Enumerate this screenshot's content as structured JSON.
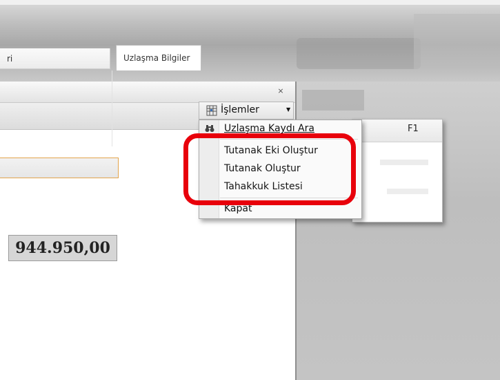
{
  "dialog": {
    "tabs": [
      {
        "label": "ri"
      },
      {
        "label": "Uzlaşma Bilgiler"
      }
    ],
    "amount": "944.950,00"
  },
  "menu": {
    "title": "İşlemler",
    "items": [
      {
        "label": "Uzlaşma Kaydı Ara",
        "icon": "search-record-icon"
      },
      {
        "label": "Tutanak Eki Oluştur"
      },
      {
        "label": "Tutanak Oluştur"
      },
      {
        "label": "Tahakkuk Listesi"
      },
      {
        "label": "Kapat"
      }
    ]
  },
  "side_panel": {
    "shortcut": "F1"
  },
  "colors": {
    "highlight": "#e8000b",
    "field_border": "#e2a34a"
  }
}
